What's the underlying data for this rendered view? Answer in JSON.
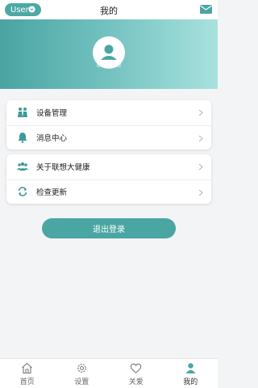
{
  "header": {
    "user_button_label": "User",
    "title": "我的"
  },
  "menu_group_1": [
    {
      "label": "设备管理",
      "icon": "devices-icon"
    },
    {
      "label": "消息中心",
      "icon": "bell-icon"
    }
  ],
  "menu_group_2": [
    {
      "label": "关于联想大健康",
      "icon": "people-icon"
    },
    {
      "label": "检查更新",
      "icon": "refresh-icon"
    }
  ],
  "logout_label": "退出登录",
  "tabs": [
    {
      "label": "首页",
      "icon": "home-icon",
      "active": false
    },
    {
      "label": "设置",
      "icon": "gear-icon",
      "active": false
    },
    {
      "label": "关爱",
      "icon": "heart-icon",
      "active": false
    },
    {
      "label": "我的",
      "icon": "person-icon",
      "active": true
    }
  ],
  "colors": {
    "accent": "#4aa6a3",
    "banner_end": "#a8e2df"
  }
}
